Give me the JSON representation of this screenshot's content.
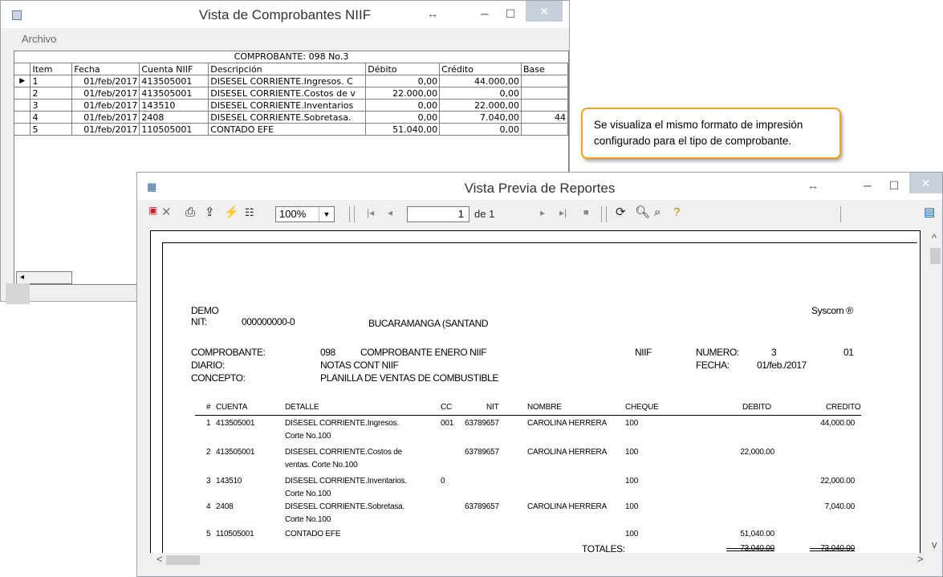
{
  "win1": {
    "title": "Vista de Comprobantes NIIF",
    "resize_glyph": "↔",
    "min_glyph": "–",
    "max_glyph": "☐",
    "close_glyph": "✕",
    "menu_archivo": "Archivo",
    "grid_caption": "COMPROBANTE: 098 No.3",
    "columns": [
      "Item",
      "Fecha",
      "Cuenta NIIF",
      "Descripción",
      "Débito",
      "Crédito",
      "Base"
    ],
    "rows": [
      {
        "item": "1",
        "fecha": "01/feb/2017",
        "cuenta": "413505001",
        "descripcion": "DISESEL CORRIENTE.Ingresos. C",
        "debito": "0,00",
        "credito": "44.000,00",
        "base": ""
      },
      {
        "item": "2",
        "fecha": "01/feb/2017",
        "cuenta": "413505001",
        "descripcion": "DISESEL CORRIENTE.Costos de v",
        "debito": "22.000,00",
        "credito": "0,00",
        "base": ""
      },
      {
        "item": "3",
        "fecha": "01/feb/2017",
        "cuenta": "143510",
        "descripcion": "DISESEL CORRIENTE.Inventarios",
        "debito": "0,00",
        "credito": "22.000,00",
        "base": ""
      },
      {
        "item": "4",
        "fecha": "01/feb/2017",
        "cuenta": "2408",
        "descripcion": "DISESEL CORRIENTE.Sobretasa.",
        "debito": "0,00",
        "credito": "7.040,00",
        "base": "44"
      },
      {
        "item": "5",
        "fecha": "01/feb/2017",
        "cuenta": "110505001",
        "descripcion": "CONTADO EFE",
        "debito": "51.040,00",
        "credito": "0,00",
        "base": ""
      }
    ],
    "row_indicator": "▶"
  },
  "callout": {
    "text": "Se visualiza el mismo formato de impresión configurado para el tipo de comprobante."
  },
  "win2": {
    "title": "Vista Previa de Reportes",
    "resize_glyph": "↔",
    "min_glyph": "–",
    "max_glyph": "☐",
    "close_glyph": "✕",
    "toolbar": {
      "zoom_value": "100%",
      "page_value": "1",
      "page_of": "de 1"
    }
  },
  "report": {
    "company": "DEMO",
    "nit_label": "NIT:",
    "nit_value": "000000000-0",
    "city": "BUCARAMANGA (SANTAND",
    "brand": "Syscom ®",
    "comprobante_label": "COMPROBANTE:",
    "comprobante_code": "098",
    "comprobante_name": "COMPROBANTE ENERO NIIF",
    "niif": "NIIF",
    "numero_label": "NUMERO:",
    "numero_value": "3",
    "numero_extra": "01",
    "diario_label": "DIARIO:",
    "diario_value": "NOTAS CONT NIIF",
    "fecha_label": "FECHA:",
    "fecha_value": "01/feb./2017",
    "concepto_label": "CONCEPTO:",
    "concepto_value": "PLANILLA DE VENTAS DE COMBUSTIBLE",
    "headers": {
      "num": "#",
      "cuenta": "CUENTA",
      "detalle": "DETALLE",
      "cc": "CC",
      "nit": "NIT",
      "nombre": "NOMBRE",
      "cheque": "CHEQUE",
      "debito": "DEBITO",
      "credito": "CREDITO"
    },
    "lines": [
      {
        "num": "1",
        "cuenta": "413505001",
        "detalle1": "DISESEL CORRIENTE.Ingresos.",
        "detalle2": "Corte No.100",
        "cc": "001",
        "nit": "63789657",
        "nombre": "CAROLINA HERRERA",
        "cheque": "100",
        "debito": "",
        "credito": "44,000.00"
      },
      {
        "num": "2",
        "cuenta": "413505001",
        "detalle1": "DISESEL CORRIENTE.Costos de",
        "detalle2": "ventas. Corte No.100",
        "cc": "",
        "nit": "63789657",
        "nombre": "CAROLINA HERRERA",
        "cheque": "100",
        "debito": "22,000.00",
        "credito": ""
      },
      {
        "num": "3",
        "cuenta": "143510",
        "detalle1": "DISESEL CORRIENTE.Inventarios.",
        "detalle2": "Corte No.100",
        "cc": "0",
        "nit": "",
        "nombre": "",
        "cheque": "100",
        "debito": "",
        "credito": "22,000.00"
      },
      {
        "num": "4",
        "cuenta": "2408",
        "detalle1": "DISESEL CORRIENTE.Sobretasa.",
        "detalle2": "Corte No.100",
        "cc": "",
        "nit": "63789657",
        "nombre": "CAROLINA HERRERA",
        "cheque": "100",
        "debito": "",
        "credito": "7,040.00"
      },
      {
        "num": "5",
        "cuenta": "110505001",
        "detalle1": "CONTADO EFE",
        "detalle2": "",
        "cc": "",
        "nit": "",
        "nombre": "",
        "cheque": "100",
        "debito": "51,040.00",
        "credito": ""
      }
    ],
    "totales_label": "TOTALES:",
    "total_debito": "73,040.00",
    "total_credito": "73,040.00"
  }
}
